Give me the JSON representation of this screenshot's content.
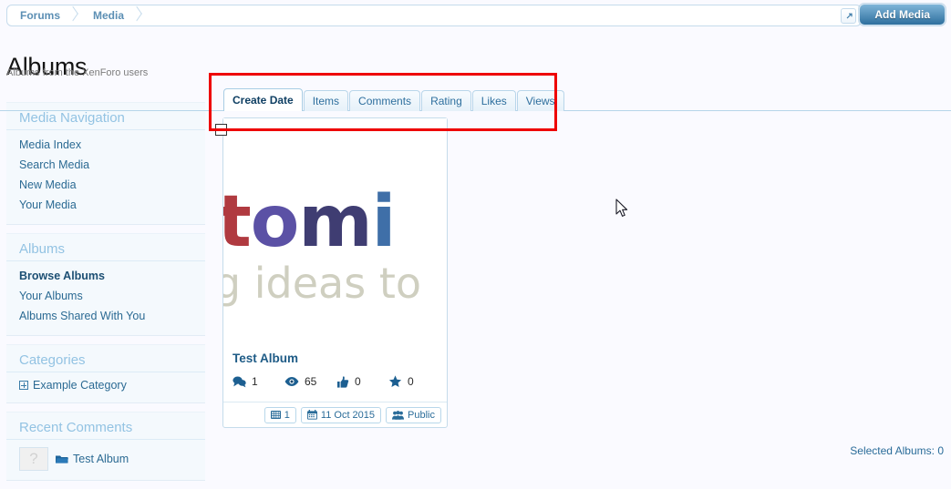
{
  "topbar": {
    "breadcrumbs": [
      {
        "label": "Forums"
      },
      {
        "label": "Media"
      }
    ],
    "jump_icon": "external-link-icon",
    "add_media_label": "Add Media"
  },
  "page": {
    "title": "Albums",
    "description": "Albums from the XenForo users"
  },
  "sidebar": {
    "blocks": [
      {
        "heading": "Media Navigation",
        "links": [
          {
            "label": "Media Index",
            "active": false
          },
          {
            "label": "Search Media",
            "active": false
          },
          {
            "label": "New Media",
            "active": false
          },
          {
            "label": "Your Media",
            "active": false
          }
        ]
      },
      {
        "heading": "Albums",
        "links": [
          {
            "label": "Browse Albums",
            "active": true
          },
          {
            "label": "Your Albums",
            "active": false
          },
          {
            "label": "Albums Shared With You",
            "active": false
          }
        ]
      },
      {
        "heading": "Categories",
        "category": {
          "label": "Example Category",
          "expander_icon": "plus-box-icon"
        }
      },
      {
        "heading": "Recent Comments",
        "comment": {
          "avatar_placeholder": "?",
          "folder_icon": "folder-icon",
          "title": "Test Album"
        }
      }
    ]
  },
  "tabs": [
    {
      "label": "Create Date",
      "active": true
    },
    {
      "label": "Items",
      "active": false
    },
    {
      "label": "Comments",
      "active": false
    },
    {
      "label": "Rating",
      "active": false
    },
    {
      "label": "Likes",
      "active": false
    },
    {
      "label": "Views",
      "active": false
    }
  ],
  "album": {
    "checkbox_checked": false,
    "title": "Test Album",
    "thumbnail": {
      "word": "stomi",
      "subtitle": "ing ideas to",
      "letter_colors": [
        "#ee4a55",
        "#b03a40",
        "#5b51a5",
        "#3f3d72",
        "#3f3d72",
        "#3f6fa8"
      ]
    },
    "stats": [
      {
        "icon": "comment-icon",
        "value": "1"
      },
      {
        "icon": "eye-icon",
        "value": "65"
      },
      {
        "icon": "thumbs-up-icon",
        "value": "0"
      },
      {
        "icon": "star-icon",
        "value": "0"
      }
    ],
    "badges": [
      {
        "icon": "grid-icon",
        "label": "1"
      },
      {
        "icon": "calendar-icon",
        "label": "11 Oct 2015"
      },
      {
        "icon": "group-icon",
        "label": "Public"
      }
    ]
  },
  "footer": {
    "selected_albums": "Selected Albums: 0"
  },
  "annotation": {
    "color": "#ee0000"
  }
}
